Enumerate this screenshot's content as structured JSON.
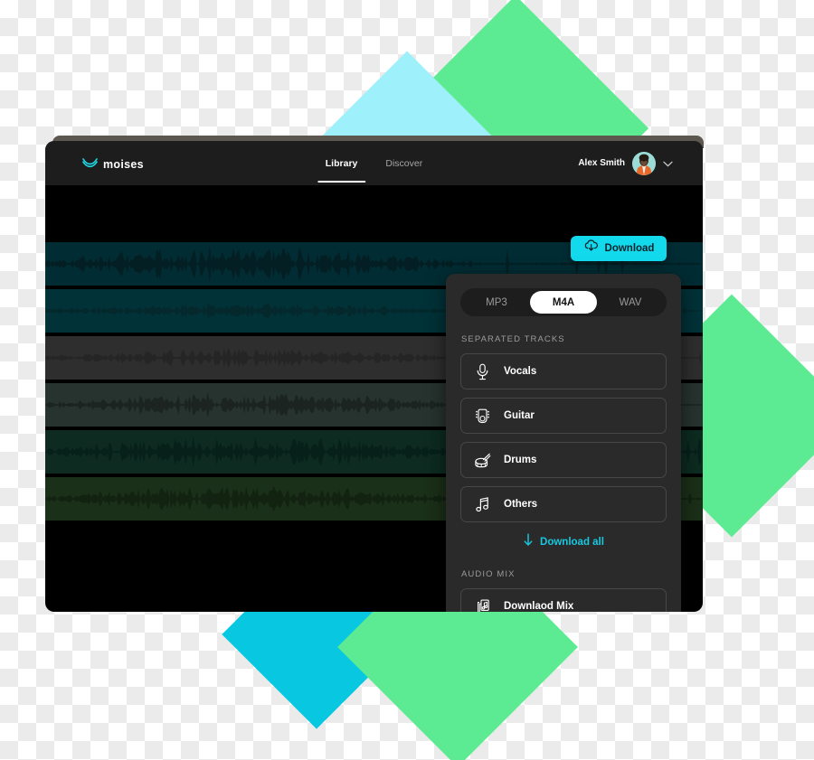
{
  "brand": {
    "logo_icon": "moises-wave-logo-icon",
    "name": "moises",
    "accent_cyan": "#12d9ec",
    "accent_green": "#5ceb92"
  },
  "topnav": {
    "tabs": [
      {
        "label": "Library",
        "active": true
      },
      {
        "label": "Discover",
        "active": false
      }
    ],
    "user": {
      "name": "Alex Smith",
      "avatar_icon": "user-avatar",
      "chevron_icon": "chevron-down-icon"
    }
  },
  "download_button": {
    "label": "Download",
    "icon": "cloud-download-icon"
  },
  "panel": {
    "formats": [
      {
        "label": "MP3",
        "selected": false
      },
      {
        "label": "M4A",
        "selected": true
      },
      {
        "label": "WAV",
        "selected": false
      }
    ],
    "separated_tracks_label": "SEPARATED TRACKS",
    "tracks": [
      {
        "label": "Vocals",
        "icon": "microphone-icon"
      },
      {
        "label": "Guitar",
        "icon": "guitar-headstock-icon"
      },
      {
        "label": "Drums",
        "icon": "drum-icon"
      },
      {
        "label": "Others",
        "icon": "music-note-icon"
      }
    ],
    "download_all": {
      "label": "Download all",
      "icon": "arrow-down-icon"
    },
    "audio_mix_label": "AUDIO MIX",
    "mix": {
      "label": "Downlaod Mix",
      "icon": "stacked-audio-files-icon"
    }
  },
  "editor": {
    "waveform_tracks": [
      {
        "name": "track-1",
        "fill": "#012c33",
        "wave": "#041f23",
        "amp": 1.0,
        "seed": 1
      },
      {
        "name": "track-2",
        "fill": "#013238",
        "wave": "#04282c",
        "amp": 0.45,
        "seed": 2
      },
      {
        "name": "track-3",
        "fill": "#2e2e2e",
        "wave": "#252525",
        "amp": 0.55,
        "seed": 3
      },
      {
        "name": "track-4",
        "fill": "#27332f",
        "wave": "#1b2420",
        "amp": 0.7,
        "seed": 4
      },
      {
        "name": "track-5",
        "fill": "#0d2b20",
        "wave": "#07201a",
        "amp": 0.85,
        "seed": 5
      },
      {
        "name": "track-6",
        "fill": "#1b3018",
        "wave": "#122311",
        "amp": 0.75,
        "seed": 6
      }
    ]
  }
}
